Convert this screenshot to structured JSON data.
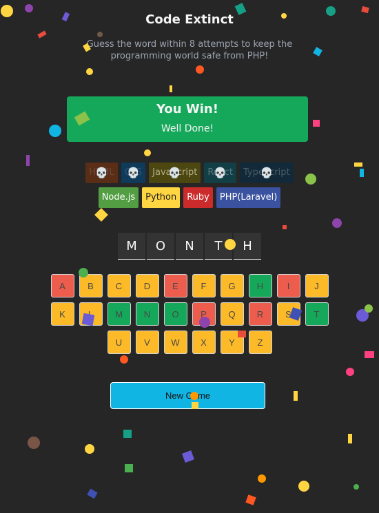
{
  "header": {
    "title": "Code Extinct",
    "subtitle": "Guess the word within 8 attempts to keep the programming world safe from PHP!"
  },
  "status": {
    "title": "You Win!",
    "message": "Well Done!"
  },
  "languages": [
    {
      "name": "HTML",
      "bg": "#5a2d16",
      "color": "#6a4a3a",
      "lost": true
    },
    {
      "name": "CSS",
      "bg": "#0f3a5a",
      "color": "#325577",
      "lost": true
    },
    {
      "name": "JavaScript",
      "bg": "#4c4710",
      "color": "#b5ae8c",
      "lost": true
    },
    {
      "name": "React",
      "bg": "#123e46",
      "color": "#5a7a80",
      "lost": true
    },
    {
      "name": "TypeScript",
      "bg": "#12293a",
      "color": "#4a5a68",
      "lost": true
    },
    {
      "name": "Node.js",
      "bg": "#539e43",
      "color": "#ffffff",
      "lost": false
    },
    {
      "name": "Python",
      "bg": "#ffd642",
      "color": "#1e1e1e",
      "lost": false
    },
    {
      "name": "Ruby",
      "bg": "#cc2b2b",
      "color": "#ffffff",
      "lost": false
    },
    {
      "name": "PHP(Laravel)",
      "bg": "#3a52a0",
      "color": "#ffffff",
      "lost": false
    }
  ],
  "skull_icon": "💀",
  "word": [
    "M",
    "O",
    "N",
    "T",
    "H"
  ],
  "keyboard": {
    "rows": [
      [
        "A",
        "B",
        "C",
        "D",
        "E",
        "F",
        "G",
        "H",
        "I",
        "J"
      ],
      [
        "K",
        "L",
        "M",
        "N",
        "O",
        "P",
        "Q",
        "R",
        "S",
        "T"
      ],
      [
        "U",
        "V",
        "W",
        "X",
        "Y",
        "Z"
      ]
    ],
    "states": {
      "A": "wrong",
      "B": "idle",
      "C": "idle",
      "D": "idle",
      "E": "wrong",
      "F": "idle",
      "G": "idle",
      "H": "right",
      "I": "wrong",
      "J": "idle",
      "K": "idle",
      "L": "idle",
      "M": "right",
      "N": "right",
      "O": "right",
      "P": "wrong",
      "Q": "idle",
      "R": "wrong",
      "S": "idle",
      "T": "right",
      "U": "idle",
      "V": "idle",
      "W": "idle",
      "X": "idle",
      "Y": "idle",
      "Z": "idle"
    }
  },
  "actions": {
    "new_game": "New Game"
  },
  "colors": {
    "background": "#262626",
    "win": "#15a85a",
    "key_wrong": "#ec5d4e",
    "key_right": "#15a85a",
    "key_idle": "#fcba29",
    "button": "#11b5e4"
  }
}
